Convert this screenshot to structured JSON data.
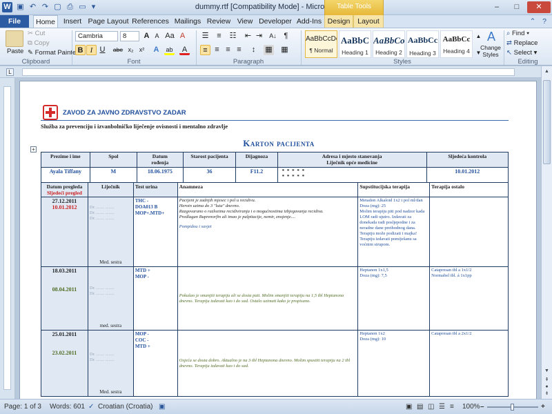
{
  "window": {
    "title": "dummy.rtf [Compatibility Mode] - Microsoft Word",
    "contextual_tab_group": "Table Tools",
    "controls": {
      "minimize": "–",
      "maximize": "□",
      "close": "✕"
    }
  },
  "tabs": [
    "File",
    "Home",
    "Insert",
    "Page Layout",
    "References",
    "Mailings",
    "Review",
    "View",
    "Developer",
    "Add-Ins",
    "Design",
    "Layout"
  ],
  "ribbon": {
    "clipboard": {
      "paste": "Paste",
      "cut": "Cut",
      "copy": "Copy",
      "format_painter": "Format Painter",
      "label": "Clipboard"
    },
    "font": {
      "name": "Cambria",
      "size": "8",
      "label": "Font",
      "grow": "A",
      "shrink": "A",
      "case": "Aa",
      "clear": "A",
      "bold": "B",
      "italic": "I",
      "underline": "U",
      "strike": "abe",
      "sub": "x₂",
      "sup": "x²",
      "effects": "A",
      "highlight": "ab",
      "color": "A"
    },
    "paragraph": {
      "label": "Paragraph",
      "pilcrow": "¶",
      "sort": "A↓"
    },
    "styles": {
      "label": "Styles",
      "items": [
        {
          "preview": "AaBbCcDc",
          "name": "¶ Normal"
        },
        {
          "preview": "AaBbC",
          "name": "Heading 1"
        },
        {
          "preview": "AaBbCo",
          "name": "Heading 2"
        },
        {
          "preview": "AaBbCc",
          "name": "Heading 3"
        },
        {
          "preview": "AaBbCc",
          "name": "Heading 4"
        }
      ],
      "change_styles": "Change Styles"
    },
    "editing": {
      "find": "Find",
      "replace": "Replace",
      "select": "Select",
      "label": "Editing"
    }
  },
  "document": {
    "org_name": "ZAVOD ZA JAVNO ZDRAVSTVO ZADAR",
    "service_line": "Služba za prevenciju i izvanbolničko liječenje ovisnosti i mentalno zdravlje",
    "card_title": "Karton pacijenta",
    "table_marker": "+",
    "header": {
      "cols": [
        "Prezime i ime",
        "Spol",
        "Datum rođenja",
        "Starost pacijenta",
        "Dijagnoza",
        "Adresa i mjesto stanovanja\nLiječnik opće medicine",
        "Sljedeća kontrola"
      ],
      "values": [
        "Ayala Tiffany",
        "M",
        "18.06.1975",
        "36",
        "F11.2",
        "* * * * *\n* * * * *",
        "10.01.2012"
      ]
    },
    "visit_header": {
      "date_label": "Datum pregleda",
      "next_label": "Sljedeći pregled",
      "doctor": "Liječnik",
      "urine": "Test urina",
      "anamnesis": "Anamneza",
      "substitution": "Supstitucijska terapija",
      "other": "Terapija ostalo"
    },
    "visits": [
      {
        "date": "27.12.2011",
        "next": "10.01.2012",
        "next_color": "#cc1f1f",
        "doctor_top": "Dr. ....... ........\nDr. ....... ........\nDr. ....... ........",
        "doctor_bottom": "Med. sestra",
        "urine": "THC -\nDOA013 B\nMOP+.MTD+",
        "anamnesis": "Pacijent je zadnjih mjesec i pol u recidivu.\nHeroin uzima do 3 \"luta\" dnevno.\nRazgovarano o razlozima recidiviranja i o mogućnostima izbjegavanja recidiva.\nPredlagan Buprenorfin ali imao je palpitacije, nemir, znojenje....",
        "anamnesis_note": "Pompidou i savjet",
        "substitution": "Metadon Alkaloid 1x2 i pol ml/dan\nDoza (mg): 25\n   Molim terapiju piti pod nadzor kada LOM radi ujutro. Izdavati za donekada radi posljepodne i za neradne dane prethodnog dana. Terapiju može podizati i majka! Terapiju izdavati pomiješanu sa voćnim sirupom.",
        "other": ""
      },
      {
        "date": "18.03.2011",
        "next": "08.04.2011",
        "next_color": "#4f6b22",
        "doctor_top": "Dr. ....... ........\nDr. ....... ........",
        "doctor_bottom": "med. sestra",
        "urine": "MTD +\nMOP -",
        "anamnesis": "Pokušao je smanjiti terapiju ali se dosta pati. Molim smanjiti terapiju na 1,5 tbl Heptanona dnevno. Terapiju izdavati kao i do sad. Ostalo uzimati kako je propisano.",
        "anamnesis_note": "",
        "substitution": "Heptanon 1x1,5\nDoza (mg): 7,5",
        "other": "Catapresan tbl a 1x1/2\nNormabel tbl. á 1x1pp"
      },
      {
        "date": "25.01.2011",
        "next": "23.02.2011",
        "next_color": "#4f6b22",
        "doctor_top": "Dr. ....... ........\nDr. ....... ........",
        "doctor_bottom": "Med. sestra",
        "urine": "MOP -\nCOC -\nMTD +",
        "anamnesis": "Osjeća se dosta dobro. Aktualno je na 3 tbl Heptanona dnevno. Molim spustiti terapiju na 2 tbl dnevno. Terapiju izdavati kao i do sad.",
        "anamnesis_note": "",
        "substitution": "Heptanon 1x2\nDoza (mg): 10",
        "other": "Catapresan tbl a 2x1/2"
      }
    ]
  },
  "status": {
    "page": "Page: 1 of 3",
    "words": "Words: 601",
    "language": "Croatian (Croatia)",
    "zoom": "100%",
    "zoom_level": 0.5
  }
}
